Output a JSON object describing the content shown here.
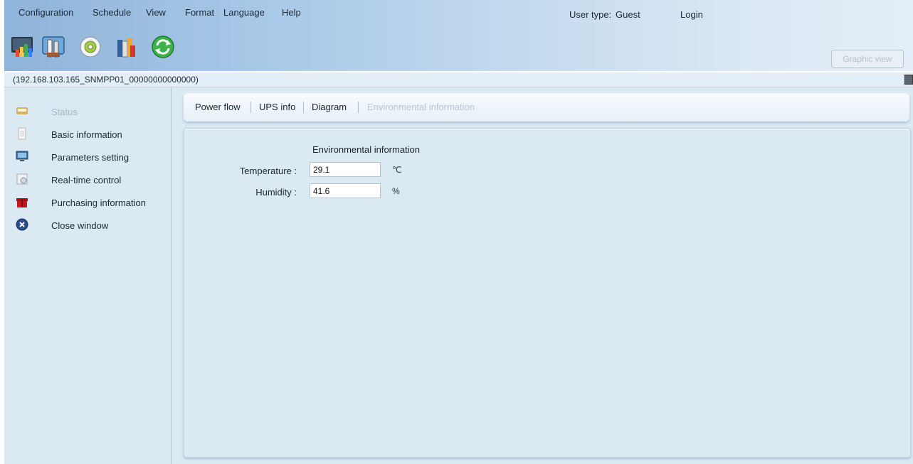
{
  "menu": {
    "configuration": "Configuration",
    "schedule": "Schedule",
    "view": "View",
    "format": "Format",
    "language": "Language",
    "help": "Help"
  },
  "user": {
    "type_label": "User type:",
    "type_value": "Guest",
    "login": "Login"
  },
  "toolbar": {
    "graphic_view": "Graphic view",
    "icons": [
      "monitor-chart-icon",
      "tools-icon",
      "cd-disc-icon",
      "books-icon",
      "refresh-icon"
    ]
  },
  "address": "(192.168.103.165_SNMPP01_00000000000000)",
  "sidebar": {
    "items": [
      {
        "label": "Status",
        "icon": "status-icon",
        "enabled": false
      },
      {
        "label": "Basic information",
        "icon": "document-icon",
        "enabled": true
      },
      {
        "label": "Parameters setting",
        "icon": "monitor-icon",
        "enabled": true
      },
      {
        "label": "Real-time control",
        "icon": "control-icon",
        "enabled": true
      },
      {
        "label": "Purchasing information",
        "icon": "gift-icon",
        "enabled": true
      },
      {
        "label": "Close window",
        "icon": "close-circle-icon",
        "enabled": true
      }
    ]
  },
  "tabs": [
    {
      "label": "Power flow",
      "active": false
    },
    {
      "label": "UPS info",
      "active": false
    },
    {
      "label": "Diagram",
      "active": false
    },
    {
      "label": "Environmental information",
      "active": true
    }
  ],
  "environment": {
    "title": "Environmental information",
    "temperature": {
      "label": "Temperature :",
      "value": "29.1",
      "unit": "℃"
    },
    "humidity": {
      "label": "Humidity :",
      "value": "41.6",
      "unit": "%"
    }
  }
}
